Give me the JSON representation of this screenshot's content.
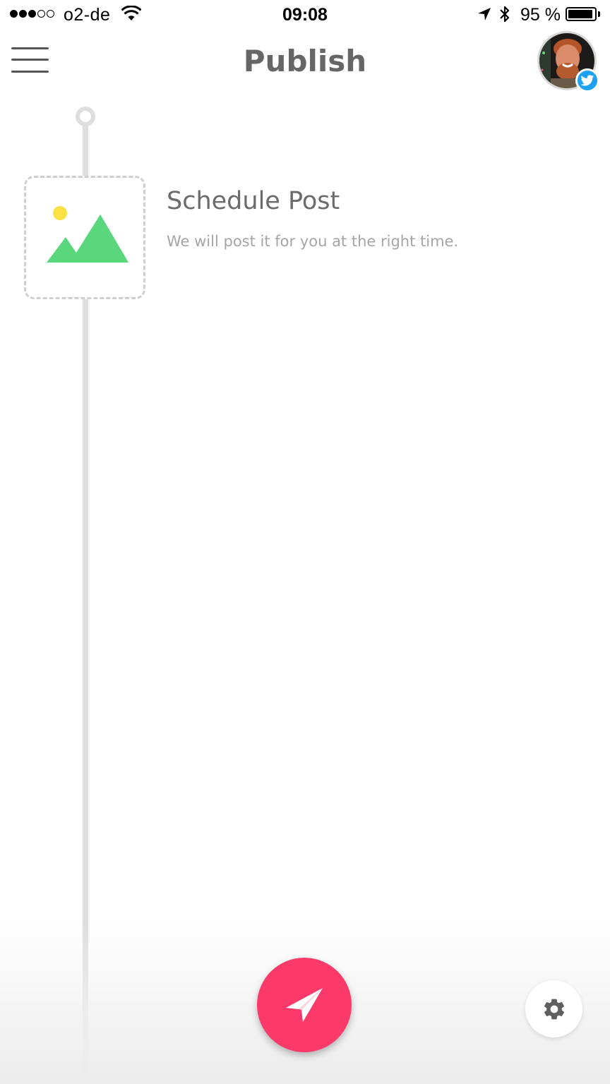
{
  "status_bar": {
    "carrier": "o2-de",
    "time": "09:08",
    "battery_percent": "95 %",
    "battery_level": 0.95,
    "signal_bars_filled": 3,
    "signal_bars_total": 5
  },
  "header": {
    "title": "Publish",
    "menu_icon": "hamburger-menu-icon",
    "avatar_badge_icon": "twitter-icon"
  },
  "post": {
    "title": "Schedule Post",
    "subtitle": "We will post it for you at the right time.",
    "thumbnail_icon": "image-placeholder-icon"
  },
  "actions": {
    "send_icon": "paper-plane-icon",
    "settings_icon": "gear-icon"
  },
  "colors": {
    "accent": "#fb3a6a",
    "twitter": "#1da1f2",
    "placeholder_green": "#5ad67d",
    "placeholder_sun": "#fce144",
    "timeline": "#dedede"
  }
}
